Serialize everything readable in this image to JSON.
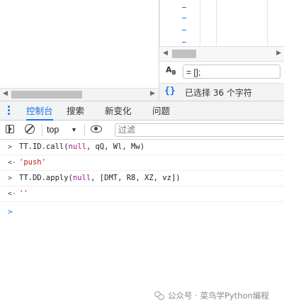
{
  "search_panel": {
    "replace_value": "= [];",
    "status_text": "已选择 36 个字符"
  },
  "drawer": {
    "tabs": [
      {
        "label": "控制台",
        "active": true
      },
      {
        "label": "搜索",
        "active": false
      },
      {
        "label": "新变化",
        "active": false
      },
      {
        "label": "问题",
        "active": false
      }
    ]
  },
  "console": {
    "context_value": "top",
    "filter_placeholder": "过滤",
    "entries": [
      {
        "kind": "input",
        "marker": ">",
        "parts": [
          {
            "text": "TT.ID.call(",
            "cls": ""
          },
          {
            "text": "null",
            "cls": "kw"
          },
          {
            "text": ", qQ, Wl, Mw)",
            "cls": ""
          }
        ]
      },
      {
        "kind": "output",
        "marker": "<·",
        "parts": [
          {
            "text": "'push'",
            "cls": "str"
          }
        ]
      },
      {
        "kind": "input",
        "marker": ">",
        "parts": [
          {
            "text": "TT.DD.apply(",
            "cls": ""
          },
          {
            "text": "null",
            "cls": "kw"
          },
          {
            "text": ", [DMT, R8, XZ, vz])",
            "cls": ""
          }
        ]
      },
      {
        "kind": "output",
        "marker": "<·",
        "parts": [
          {
            "text": "''",
            "cls": "str"
          }
        ]
      }
    ],
    "prompt_symbol": ">"
  },
  "watermark": {
    "text": "公众号 · 菜鸟学Python编程"
  },
  "colors": {
    "accent": "#1a73e8",
    "keyword": "#9a1a8c",
    "string": "#c41a16"
  }
}
